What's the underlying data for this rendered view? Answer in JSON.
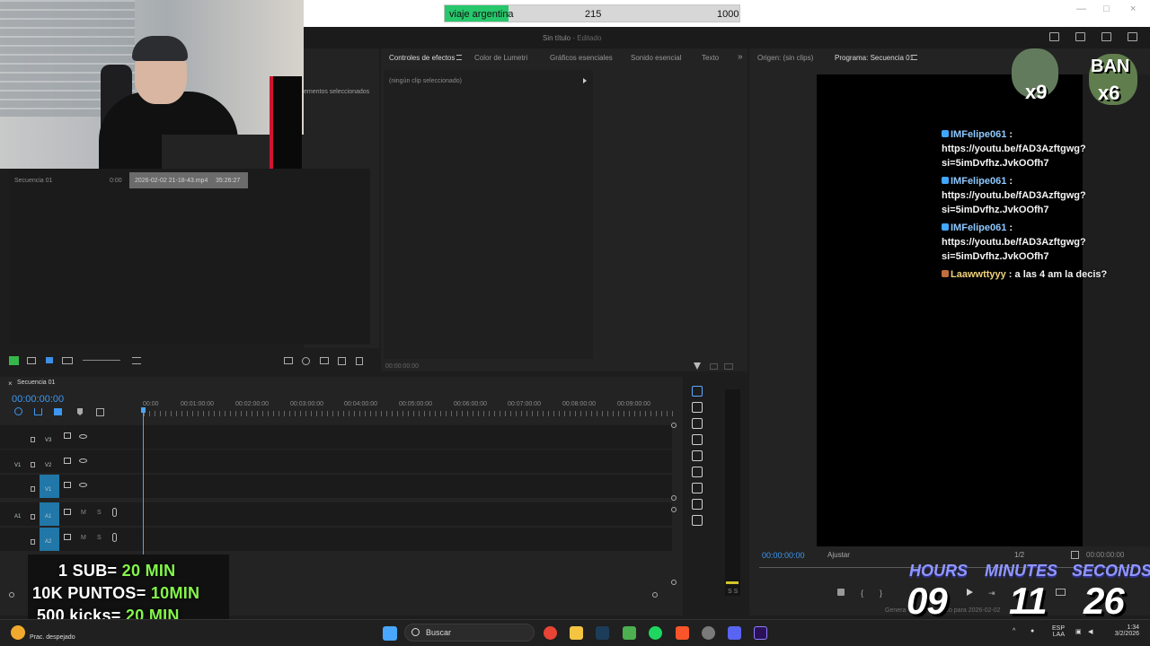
{
  "progress": {
    "label": "viaje argentina",
    "current": "215",
    "goal": "1000",
    "value": 0.215
  },
  "app": {
    "title": "Sin título",
    "subtitle": "- Editado"
  },
  "tabs": [
    {
      "label": "Controles de efectos"
    },
    {
      "label": "Color de Lumetri"
    },
    {
      "label": "Gráficos esenciales"
    },
    {
      "label": "Sonido esencial"
    },
    {
      "label": "Texto"
    },
    {
      "label": "Origen: (sin clips)"
    },
    {
      "label": "Programa: Secuencia 01"
    }
  ],
  "project": {
    "selected": "ementos seleccionados",
    "item": "Secuencia 01",
    "duration": "0:00",
    "clip": "2026-02-02 21-18-43.mp4",
    "clip_duration": "35:26:27"
  },
  "effects": {
    "empty": "(ningún clip seleccionado)",
    "time": "00:00:00:00"
  },
  "chat": [
    {
      "user": "IMFelipe061",
      "message": "https://youtu.be/fAD3Azftgwg?si=5imDvfhz.JvkOOfh7"
    },
    {
      "user": "IMFelipe061",
      "message": "https://youtu.be/fAD3Azftgwg?si=5imDvfhz.JvkOOfh7"
    },
    {
      "user": "IMFelipe061",
      "message": "https://youtu.be/fAD3Azftgwg?si=5imDvfhz.JvkOOfh7"
    },
    {
      "user": "Laawwttyyy",
      "message": "a las 4 am la decis?"
    }
  ],
  "emotes": [
    {
      "label": "x9"
    },
    {
      "label": "BAN"
    },
    {
      "label": "x6"
    }
  ],
  "timeline": {
    "name": "Secuencia 01",
    "time": "00:00:00:00",
    "ruler": [
      "00:00",
      "00:01:00:00",
      "00:02:00:00",
      "00:03:00:00",
      "00:04:00:00",
      "00:05:00:00",
      "00:06:00:00",
      "00:07:00:00",
      "00:08:00:00",
      "00:09:00:00"
    ],
    "tracks": [
      "V3",
      "V2",
      "V1",
      "A1",
      "A2"
    ]
  },
  "program": {
    "time": "00:00:00:00",
    "fit": "Ajustar",
    "fraction": "1/2",
    "end_time": "00:00:00:00"
  },
  "promo": {
    "line1_prefix": "1 SUB= ",
    "line1_value": "20 MIN",
    "line2_prefix": "10K PUNTOS= ",
    "line2_value": "10MIN",
    "line3_prefix": "500 kicks= ",
    "line3_value": "20 MIN"
  },
  "timer": {
    "hours_label": "HOURS",
    "minutes_label": "MINUTES",
    "seconds_label": "SECONDS",
    "hours": "09",
    "minutes": "11",
    "seconds": "26"
  },
  "taskbar": {
    "weather": "Prac. despejado",
    "search": "Buscar",
    "lang1": "ESP",
    "lang2": "LAA",
    "time": "1:34",
    "date": "3/2/2026"
  },
  "status": {
    "text": "Genera",
    "text2": "pico para 2026-02-02"
  }
}
